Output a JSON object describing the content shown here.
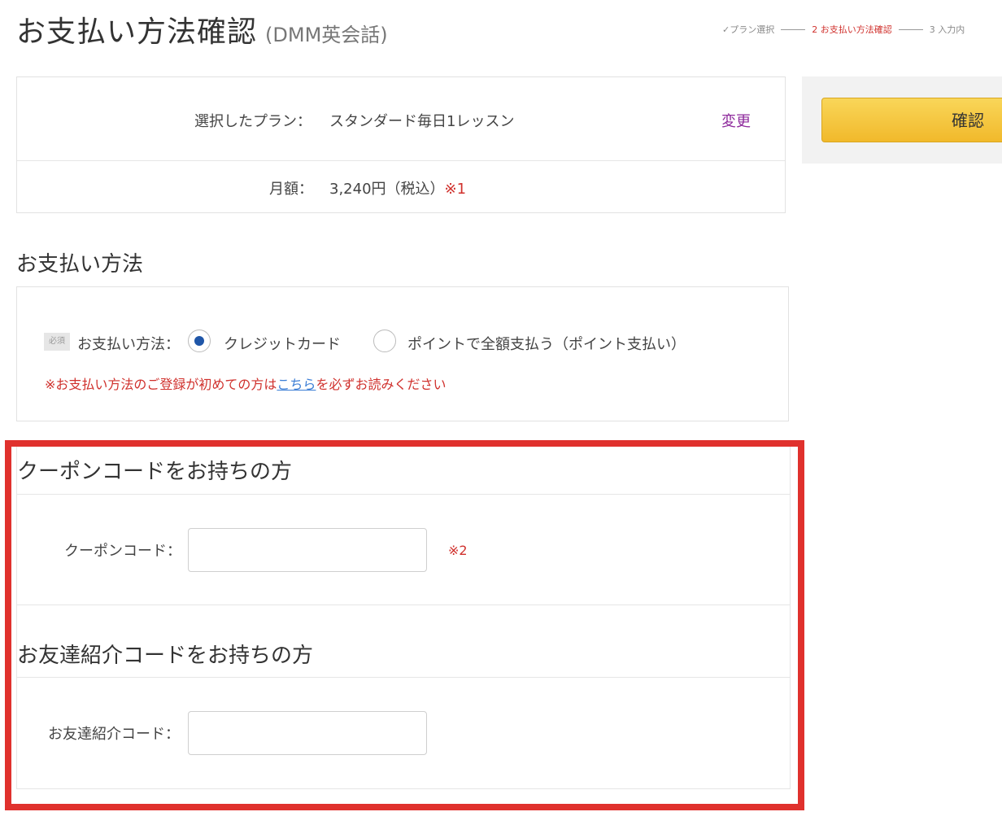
{
  "header": {
    "title": "お支払い方法確認",
    "subtitle": "(DMM英会話)",
    "steps": [
      {
        "label": "プラン選択",
        "state": "done"
      },
      {
        "label": "2 お支払い方法確認",
        "state": "active"
      },
      {
        "label": "3 入力内",
        "state": "upcoming"
      }
    ]
  },
  "plan": {
    "selected_label": "選択したプラン：",
    "selected_value": "スタンダード毎日1レッスン",
    "change_link": "変更",
    "monthly_label": "月額：",
    "monthly_value": "3,240円（税込）",
    "monthly_note": "※1"
  },
  "confirm": {
    "button_label": "確認"
  },
  "payment": {
    "heading": "お支払い方法",
    "required_badge": "必須",
    "label": "お支払い方法：",
    "options": [
      {
        "label": "クレジットカード",
        "checked": true
      },
      {
        "label": "ポイントで全額支払う（ポイント支払い）",
        "checked": false
      }
    ],
    "notice_before": "※お支払い方法のご登録が初めての方は",
    "notice_link": "こちら",
    "notice_after": "を必ずお読みください"
  },
  "coupon": {
    "heading": "クーポンコードをお持ちの方",
    "field_label": "クーポンコード：",
    "value": "",
    "note": "※2"
  },
  "referral": {
    "heading": "お友達紹介コードをお持ちの方",
    "field_label": "お友達紹介コード：",
    "value": ""
  },
  "colors": {
    "accent_red": "#d0312d",
    "highlight_frame": "#e0312d",
    "confirm_button": "#f1b92b",
    "radio_checked": "#1f56a8",
    "link_purple": "#8e2a9c",
    "link_blue": "#3d7fd6"
  }
}
